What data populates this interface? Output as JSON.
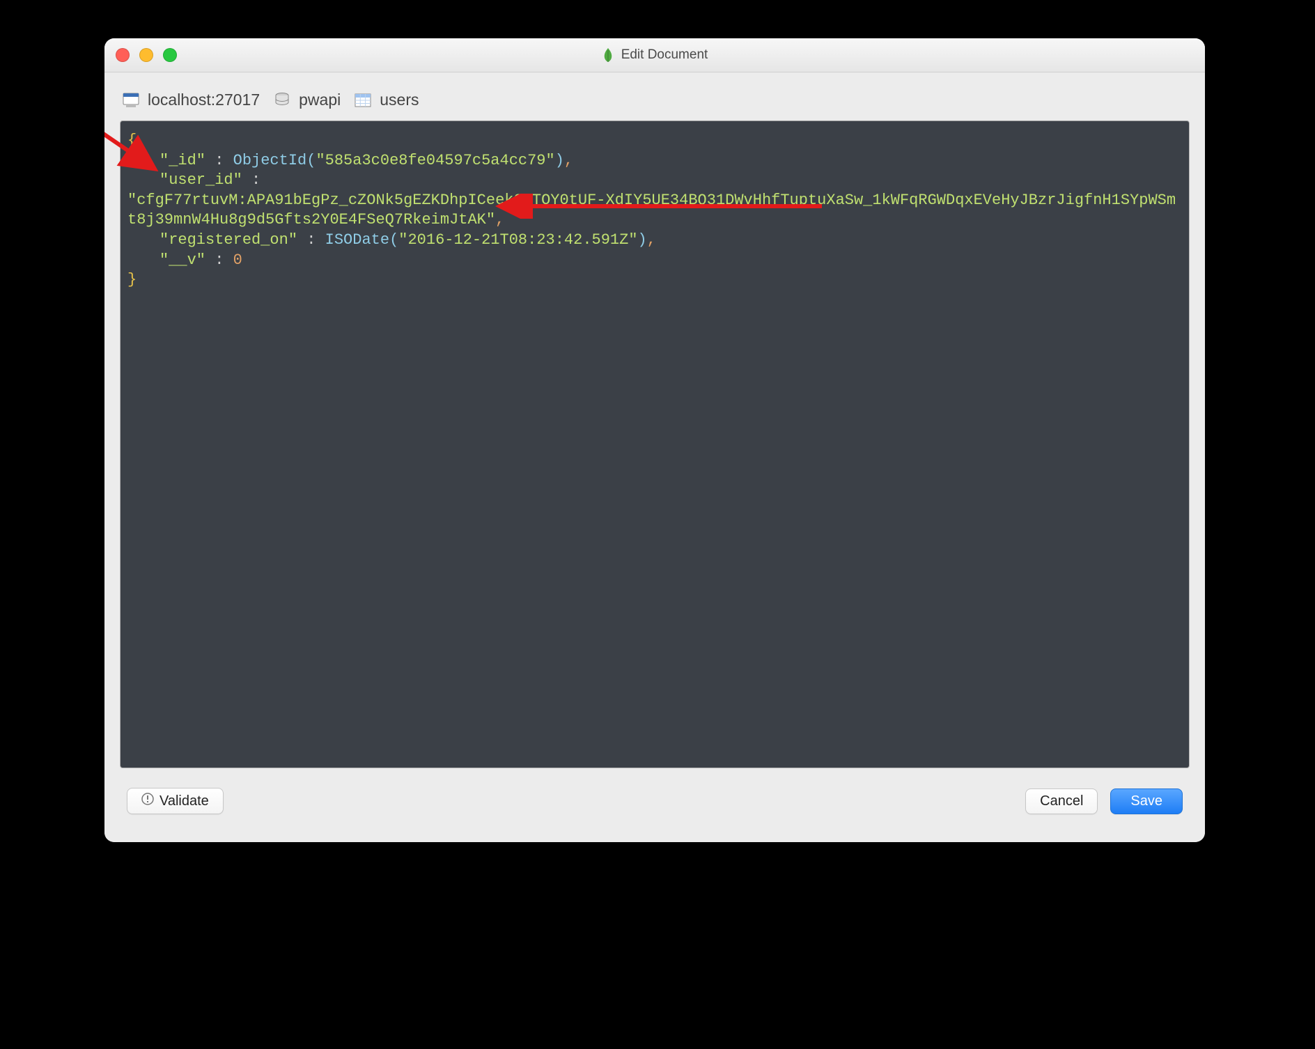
{
  "window": {
    "title": "Edit Document"
  },
  "breadcrumb": {
    "host": "localhost:27017",
    "database": "pwapi",
    "collection": "users"
  },
  "footer": {
    "validate": "Validate",
    "cancel": "Cancel",
    "save": "Save"
  },
  "code": {
    "open_brace": "{",
    "close_brace": "}",
    "comma": ",",
    "colon_sp": " : ",
    "k_id": "\"_id\"",
    "t_objectid": "ObjectId(",
    "v_objectid": "\"585a3c0e8fe04597c5a4cc79\"",
    "t_close_paren": ")",
    "k_user_id": "\"user_id\"",
    "v_user_id": "\"cfgF77rtuvM:APA91bEgPz_cZONk5gEZKDhpICeek0RTOY0tUF-XdIY5UE34BQ31DWvHhfTuptuXaSw_1kWFqRGWDqxEVeHyJBzrJigfnH1SYpWSmt8j39mnW4Hu8g9d5Gfts2Y0E4FSeQ7RkeimJtAK\"",
    "k_registered_on": "\"registered_on\"",
    "t_isodate": "ISODate(",
    "v_isodate": "\"2016-12-21T08:23:42.591Z\"",
    "k_v": "\"__v\"",
    "v_v": "0"
  }
}
